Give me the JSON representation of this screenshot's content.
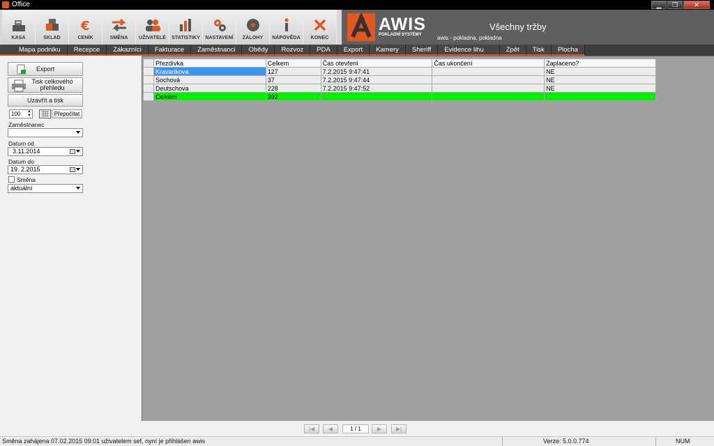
{
  "window": {
    "title": "Office",
    "buttons": {
      "minimize": "▁",
      "maximize": "❐",
      "close": "✕"
    }
  },
  "toolbar": {
    "buttons": [
      {
        "label": "KASA",
        "icon": "cash-register-icon"
      },
      {
        "label": "SKLAD",
        "icon": "boxes-icon"
      },
      {
        "label": "CENÍK",
        "icon": "euro-icon"
      },
      {
        "label": "SMĚNA",
        "icon": "swap-arrows-icon"
      },
      {
        "label": "UŽIVATELÉ",
        "icon": "users-icon"
      },
      {
        "label": "STATISTIKY",
        "icon": "bar-chart-icon"
      },
      {
        "label": "NASTAVENÍ",
        "icon": "gears-icon"
      },
      {
        "label": "ZÁLOHY",
        "icon": "disc-icon"
      },
      {
        "label": "NÁPOVĚDA",
        "icon": "info-icon"
      },
      {
        "label": "KONEC",
        "icon": "close-x-icon"
      }
    ]
  },
  "brand": {
    "name": "AWIS",
    "subtitle": "POKLADNÍ SYSTÉMY",
    "page_title": "Všechny tržby",
    "user_line": "awis  -  pokladna, pokladna",
    "accent": "#e4561d"
  },
  "menu": [
    "Mapa podniku",
    "Recepce",
    "Zákazníci",
    "Fakturace",
    "Zaměstnanci",
    "Obědy",
    "Rozvoz",
    "PDA",
    "Export",
    "Kamery",
    "Sheriff",
    "Evidence lihu",
    "Zpět",
    "Tisk",
    "Plocha"
  ],
  "left": {
    "export_label": "Export",
    "print_label_1": "Tisk celkového",
    "print_label_2": "přehledu",
    "close_print_label": "Uzavřít a tisk",
    "spinner_value": "100",
    "recalc_label": "Přepočítat",
    "employee_label": "Zaměstnanec",
    "employee_value": "",
    "date_from_label": "Datum od",
    "date_from_value": "3.11.2014",
    "date_to_label": "Datum do",
    "date_to_value": "19.  2.2015",
    "shift_label": "Směna",
    "shift_value": "aktuální"
  },
  "grid": {
    "columns": [
      "Přezdívka",
      "Celkem",
      "Čas otevření",
      "Čas ukončení",
      "Zaplaceno?"
    ],
    "rows": [
      [
        "Kravarikova",
        "127",
        "7.2.2015 9:47:41",
        "",
        "NE"
      ],
      [
        "Sochová",
        "37",
        "7.2.2015 9:47:44",
        "",
        "NE"
      ],
      [
        "Deutschova",
        "228",
        "7.2.2015 9:47:52",
        "",
        "NE"
      ]
    ],
    "total": [
      "Celkem",
      "392",
      "",
      "",
      ""
    ],
    "total_color": "#00f000",
    "selected_color": "#3a96f4"
  },
  "pager": {
    "first": "|◀",
    "prev": "◀",
    "page": "1 / 1",
    "next": "▶",
    "last": "▶|"
  },
  "status": {
    "left": "Směna zahájena 07.02.2015 09:01 uživatelem sef, nyní je přihlášen awis",
    "version": "Verze: 5.0.0.774",
    "num": "NUM"
  }
}
